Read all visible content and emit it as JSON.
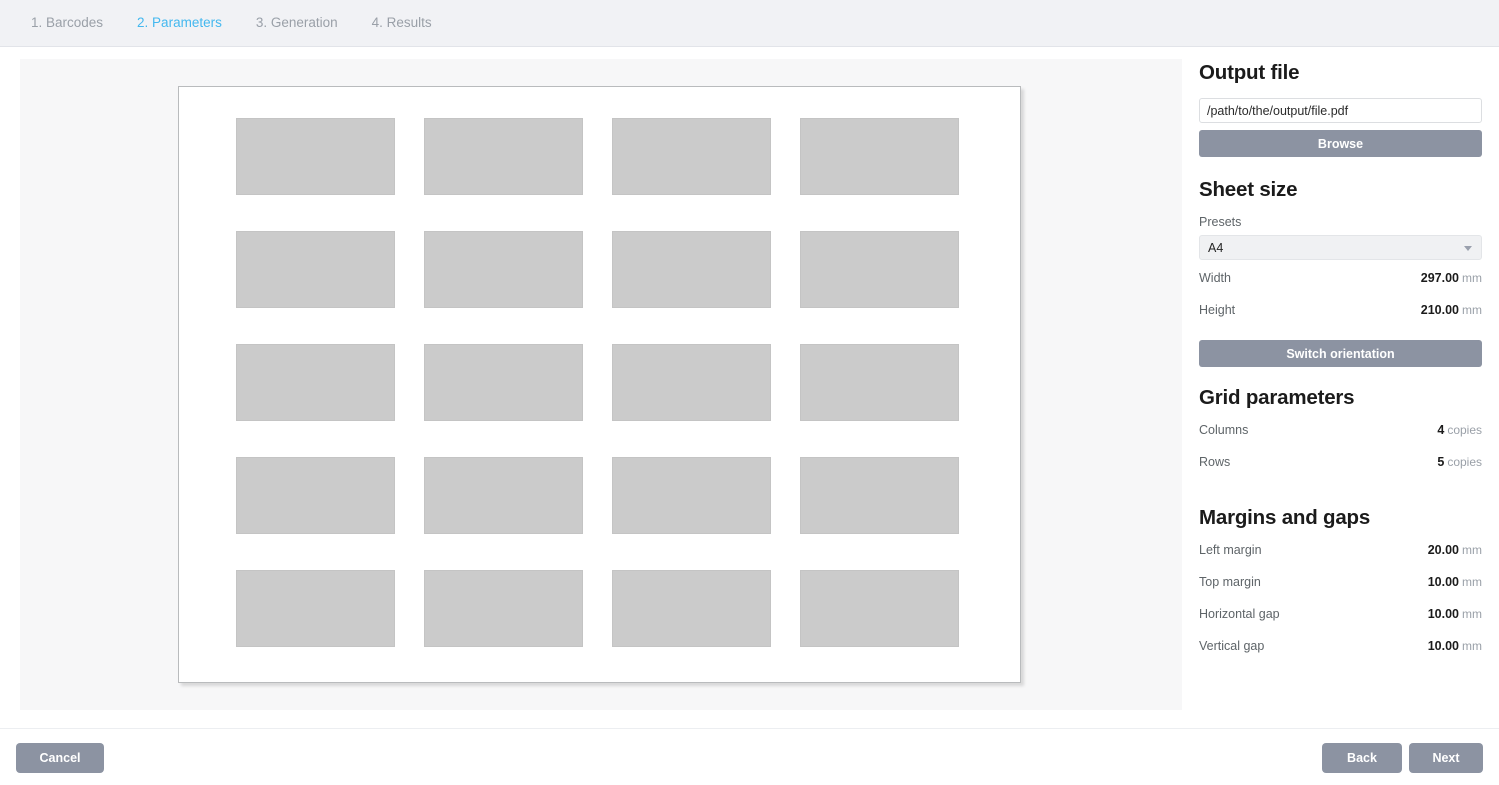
{
  "wizard": {
    "steps": [
      {
        "label": "1. Barcodes",
        "active": false
      },
      {
        "label": "2. Parameters",
        "active": true
      },
      {
        "label": "3. Generation",
        "active": false
      },
      {
        "label": "4. Results",
        "active": false
      }
    ],
    "active_color": "#44b8ef",
    "inactive_color": "#9aa0a8"
  },
  "preview": {
    "columns": 4,
    "rows": 5,
    "cell_count": 20,
    "cell_color": "#cbcbcb",
    "sheet_color": "#ffffff"
  },
  "settings": {
    "output_file": {
      "title": "Output file",
      "path_value": "/path/to/the/output/file.pdf",
      "path_placeholder": "/path/to/the/output/file.pdf",
      "browse_label": "Browse"
    },
    "sheet_size": {
      "title": "Sheet size",
      "presets_label": "Presets",
      "preset_value": "A4",
      "preset_options": [
        "A4"
      ],
      "width_label": "Width",
      "width_value": "297.00",
      "width_unit": "mm",
      "height_label": "Height",
      "height_value": "210.00",
      "height_unit": "mm",
      "switch_orientation_label": "Switch orientation"
    },
    "grid_parameters": {
      "title": "Grid parameters",
      "columns_label": "Columns",
      "columns_value": "4",
      "columns_unit": "copies",
      "rows_label": "Rows",
      "rows_value": "5",
      "rows_unit": "copies"
    },
    "margins_and_gaps": {
      "title": "Margins and gaps",
      "left_margin_label": "Left margin",
      "left_margin_value": "20.00",
      "left_margin_unit": "mm",
      "top_margin_label": "Top margin",
      "top_margin_value": "10.00",
      "top_margin_unit": "mm",
      "horizontal_gap_label": "Horizontal gap",
      "horizontal_gap_value": "10.00",
      "horizontal_gap_unit": "mm",
      "vertical_gap_label": "Vertical gap",
      "vertical_gap_value": "10.00",
      "vertical_gap_unit": "mm"
    }
  },
  "footer": {
    "cancel_label": "Cancel",
    "back_label": "Back",
    "next_label": "Next",
    "button_color": "#8c93a2"
  }
}
